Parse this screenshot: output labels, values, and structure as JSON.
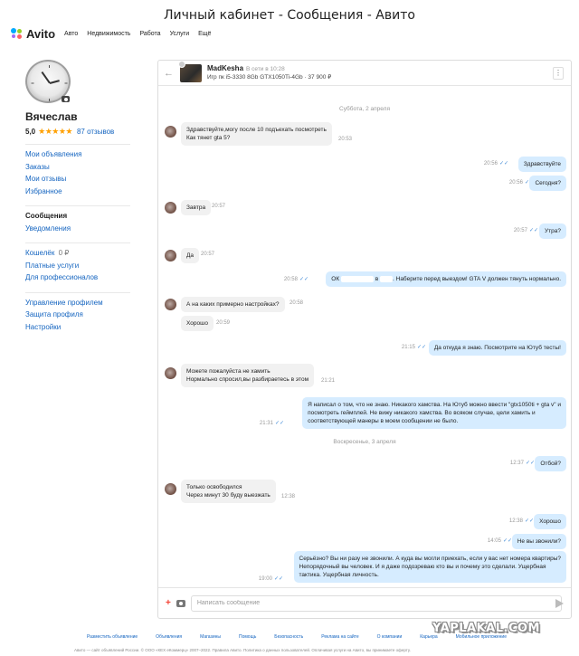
{
  "window": {
    "title": "Личный кабинет - Сообщения - Авито"
  },
  "topnav": {
    "logo": "Avito",
    "items": [
      "Авто",
      "Недвижимость",
      "Работа",
      "Услуги",
      "Ещё"
    ]
  },
  "profile": {
    "name": "Вячеслав",
    "rating": "5,0",
    "stars": "★★★★★",
    "reviews": "87 отзывов"
  },
  "sidebar": {
    "group1": [
      "Мои объявления",
      "Заказы",
      "Мои отзывы",
      "Избранное"
    ],
    "group2": [
      "Сообщения",
      "Уведомления"
    ],
    "wallet_label": "Кошелёк",
    "wallet_amount": "0 ₽",
    "group3": [
      "Платные услуги",
      "Для профессионалов"
    ],
    "group4": [
      "Управление профилем",
      "Защита профиля",
      "Настройки"
    ]
  },
  "chat": {
    "seller": "MadKesha",
    "seller_status": "В сети в 10:28",
    "product": "Игр пк i5-3330 8Gb GTX1050Ti-4Gb · 37 900 ₽",
    "date1": "Суббота, 2 апреля",
    "date2": "Воскресенье, 3 апреля",
    "messages": [
      {
        "dir": "in",
        "lines": [
          "Здравствуйте,могу после 10 подъехать посмотреть",
          "Как тянет gta 5?"
        ],
        "time": "20:53"
      },
      {
        "dir": "out",
        "lines": [
          "Здравствуйте"
        ],
        "time": "20:56"
      },
      {
        "dir": "out",
        "lines": [
          "Сегодня?"
        ],
        "time": "20:56"
      },
      {
        "dir": "in",
        "lines": [
          "Завтра"
        ],
        "time": "20:57"
      },
      {
        "dir": "out",
        "lines": [
          "Утра?"
        ],
        "time": "20:57"
      },
      {
        "dir": "in",
        "lines": [
          "Да"
        ],
        "time": "20:57"
      },
      {
        "dir": "out",
        "pre": "ОК",
        "mid": "в",
        "post": ". Наберите перед выездом! GTA V должен тянуть нормально.",
        "time": "20:58"
      },
      {
        "dir": "in",
        "lines": [
          "А на каких примерно настройках?"
        ],
        "time": "20:58"
      },
      {
        "dir": "in",
        "lines": [
          "Хорошо"
        ],
        "time": "20:59"
      },
      {
        "dir": "out",
        "lines": [
          "Да откуда я знаю. Посмотрите на Ютуб тесты!"
        ],
        "time": "21:15"
      },
      {
        "dir": "in",
        "lines": [
          "Можете пожалуйста не хамить",
          "Нормально спросил,вы разбираетесь в этом"
        ],
        "time": "21:21"
      },
      {
        "dir": "out",
        "lines": [
          "Я написал о том, что не знаю. Никакого хамства. На Ютуб можно ввести \"gtx1050ti + gta v\" и",
          "посмотреть геймплей. Не вижу никакого хамства. Во всяком случае, цели хамить и",
          "соответствующей манеры в моем сообщении не было."
        ],
        "time": "21:31"
      },
      {
        "dir": "out",
        "lines": [
          "Отбой?"
        ],
        "time": "12:37"
      },
      {
        "dir": "in",
        "lines": [
          "Только освободился",
          "Через минут 30 буду выезжать"
        ],
        "time": "12:38"
      },
      {
        "dir": "out",
        "lines": [
          "Хорошо"
        ],
        "time": "12:38"
      },
      {
        "dir": "out",
        "lines": [
          "Не вы звонили?"
        ],
        "time": "14:05"
      },
      {
        "dir": "out",
        "lines": [
          "Серьёзно? Вы ни разу не звонили. А куда вы могли приехать, если у вас нет номера квартиры?",
          "Непорядочный вы человек. И я даже подозреваю кто вы и почему это сделали. Ущербная",
          "тактика. Ущербная личность."
        ],
        "time": "19:00"
      }
    ],
    "input_placeholder": "Написать сообщение"
  },
  "footer": {
    "links": [
      "Разместить объявление",
      "Объявления",
      "Магазины",
      "Помощь",
      "Безопасность",
      "Реклама на сайте",
      "О компании",
      "Карьера",
      "Мобильное приложение"
    ],
    "bottom": "Авито — сайт объявлений России. © ООО «КЕХ еКоммерц» 2007–2022. Правила Авито. Политика о данных пользователей. Оплачивая услуги на Авито, вы принимаете оферту."
  },
  "watermark": "YAPLAKAL.COM",
  "colors": {
    "accent": "#1565c0",
    "outgoing": "#d6ecff",
    "incoming": "#f1f1f1",
    "stars": "#ffa000"
  }
}
